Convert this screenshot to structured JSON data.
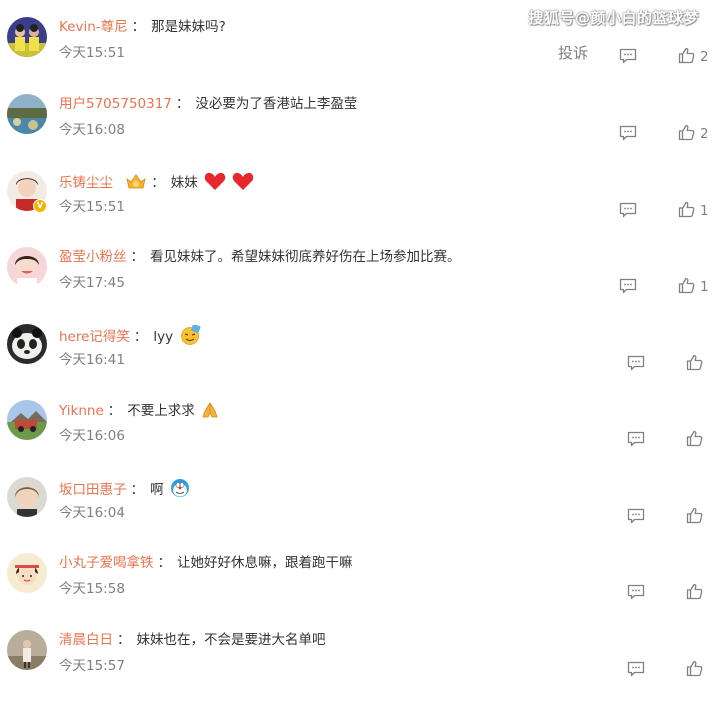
{
  "watermark": "搜狐号@颜小白的篮球梦",
  "report_label": "投诉",
  "comments": [
    {
      "user": "Kevin-尊尼",
      "sep": "：",
      "text": "那是妹妹吗?",
      "time": "今天15:51",
      "likes": "2"
    },
    {
      "user": "用户5705750317",
      "sep": "：",
      "text": "没必要为了香港站上李盈莹",
      "time": "今天16:08",
      "likes": "2"
    },
    {
      "user": "乐铸尘尘",
      "sep": "：",
      "text": "妹妹",
      "time": "今天15:51",
      "likes": "1"
    },
    {
      "user": "盈莹小粉丝",
      "sep": "：",
      "text": "看见妹妹了。希望妹妹彻底养好伤在上场参加比赛。",
      "time": "今天17:45",
      "likes": "1"
    },
    {
      "user": "here记得笑",
      "sep": "：",
      "text": "lyy",
      "time": "今天16:41",
      "likes": ""
    },
    {
      "user": "Yiknne",
      "sep": "：",
      "text": "不要上求求",
      "time": "今天16:06",
      "likes": ""
    },
    {
      "user": "坂口田惠子",
      "sep": "：",
      "text": "啊",
      "time": "今天16:04",
      "likes": ""
    },
    {
      "user": "小丸子爱喝拿铁",
      "sep": "：",
      "text": "让她好好休息嘛，跟着跑干嘛",
      "time": "今天15:58",
      "likes": ""
    },
    {
      "user": "清晨白日",
      "sep": "：",
      "text": "妹妹也在，不会是要进大名单吧",
      "time": "今天15:57",
      "likes": ""
    }
  ],
  "colors": {
    "username": "#eb7350",
    "text": "#333333",
    "meta": "#808080",
    "heart": "#e8272c"
  },
  "icons": [
    "comment-icon",
    "like-icon",
    "heart-emoji",
    "crown-emoji",
    "pray-emoji",
    "face-emoji",
    "doraemon-emoji",
    "vip-badge-icon"
  ]
}
